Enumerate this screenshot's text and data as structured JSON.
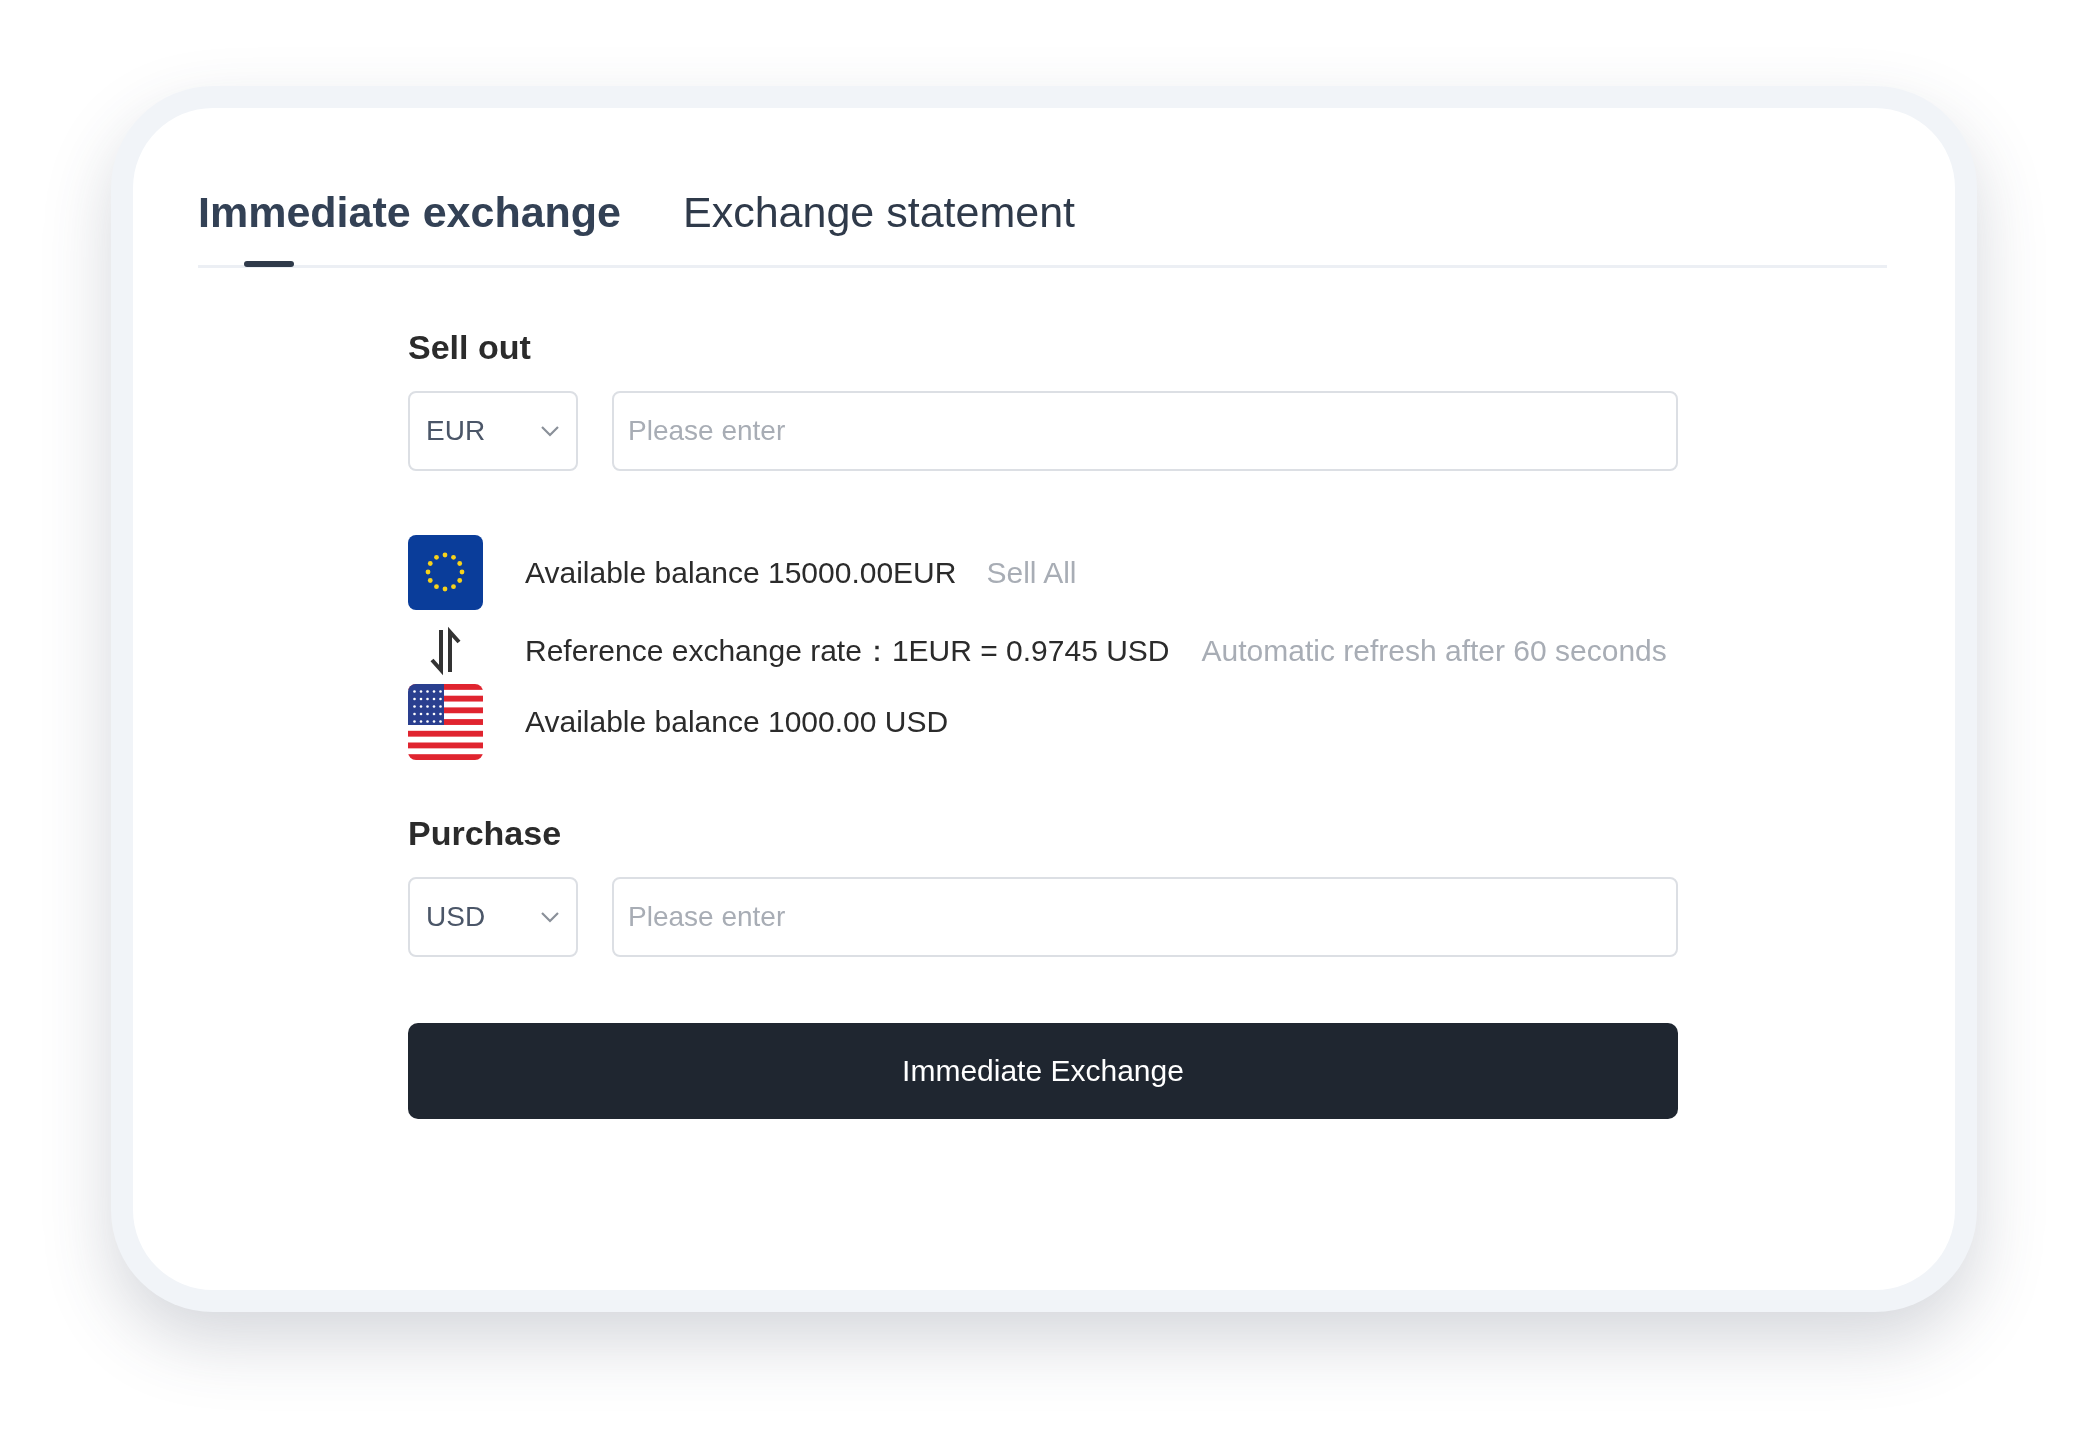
{
  "tabs": [
    {
      "label": "Immediate exchange",
      "selected": true
    },
    {
      "label": "Exchange statement",
      "selected": false
    }
  ],
  "sell": {
    "title": "Sell out",
    "currency": "EUR",
    "amount": {
      "placeholder": "Please enter"
    }
  },
  "info": [
    {
      "kind": "eu-balance",
      "text": "Available balance 15000.00EUR",
      "link": "Sell All"
    },
    {
      "kind": "rate",
      "text": "Reference exchange rate：1EUR = 0.9745 USD",
      "note": "Automatic refresh after 60 seconds"
    },
    {
      "kind": "us-balance",
      "text": "Available balance 1000.00 USD"
    }
  ],
  "purchase": {
    "title": "Purchase",
    "currency": "USD",
    "amount": {
      "placeholder": "Please enter"
    }
  },
  "submit": "Immediate Exchange"
}
